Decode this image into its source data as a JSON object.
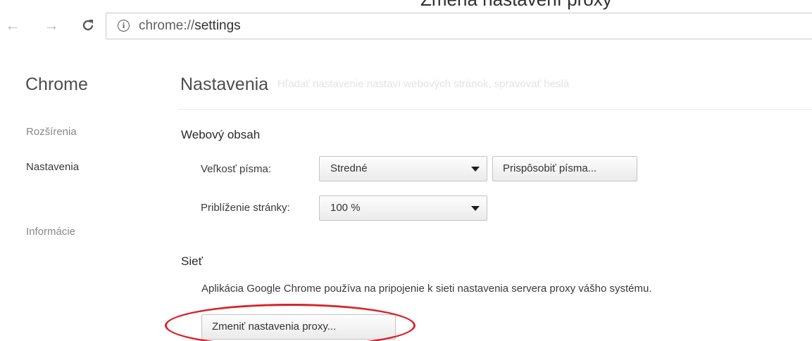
{
  "toolbar": {
    "back_icon": "arrow-left-icon",
    "forward_icon": "arrow-right-icon",
    "reload_icon": "reload-icon",
    "info_icon": "info-icon",
    "url_scheme": "chrome://",
    "url_host": "settings",
    "overlay_title": "Zmena nastavení proxy"
  },
  "sidebar": {
    "title": "Chrome",
    "items": [
      {
        "label": "Rozšírenia"
      },
      {
        "label": "Nastavenia"
      },
      {
        "label": "Informácie"
      }
    ]
  },
  "main": {
    "title": "Nastavenia",
    "search_ghost": "Hľadať nastavenie nastaví webových stránok, spravovať heslá",
    "web_content": {
      "title": "Webový obsah",
      "font_size_label": "Veľkosť písma:",
      "font_size_value": "Stredné",
      "customize_fonts_label": "Prispôsobiť písma...",
      "zoom_label": "Priblíženie stránky:",
      "zoom_value": "100 %"
    },
    "network": {
      "title": "Sieť",
      "description": "Aplikácia Google Chrome používa na pripojenie k sieti nastavenia servera proxy vášho systému.",
      "change_proxy_label": "Zmeniť nastavenia proxy..."
    }
  },
  "colors": {
    "highlight": "#d8232a"
  }
}
